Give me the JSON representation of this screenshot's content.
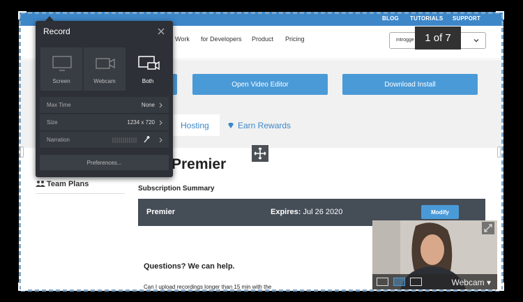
{
  "header": {
    "links": [
      "BLOG",
      "TUTORIALS",
      "SUPPORT"
    ],
    "nav": [
      "Work",
      "for Developers",
      "Product",
      "Pricing"
    ],
    "account_value": "mtrogge"
  },
  "hero": {
    "open_editor": "Open Video Editor",
    "download": "Download Install"
  },
  "tabs": {
    "hosting": "Hosting",
    "rewards": "Earn Rewards"
  },
  "main": {
    "plan_title": "Premier",
    "team_plans": "Team Plans",
    "subscription_summary": "Subscription Summary",
    "plan_name": "Premier",
    "expires_label": "Expires:",
    "expires_date": "Jul 26 2020",
    "modify": "Modify",
    "questions": "Questions? We can help.",
    "faq_question": "Can I upload recordings longer than 15 min with the"
  },
  "counter": "1 of 7",
  "record_panel": {
    "title": "Record",
    "modes": [
      "Screen",
      "Webcam",
      "Both"
    ],
    "selected_mode": "Both",
    "options": [
      {
        "key": "Max Time",
        "value": "None"
      },
      {
        "key": "Size",
        "value": "1234 x 720"
      },
      {
        "key": "Narration",
        "value": ""
      }
    ],
    "preferences": "Preferences..."
  },
  "webcam": {
    "label": "Webcam ▾"
  },
  "colors": {
    "brand_blue": "#3d87c9",
    "button_blue": "#4a9ad8",
    "panel_bg": "#2d3137",
    "plan_bar": "#454d57"
  }
}
